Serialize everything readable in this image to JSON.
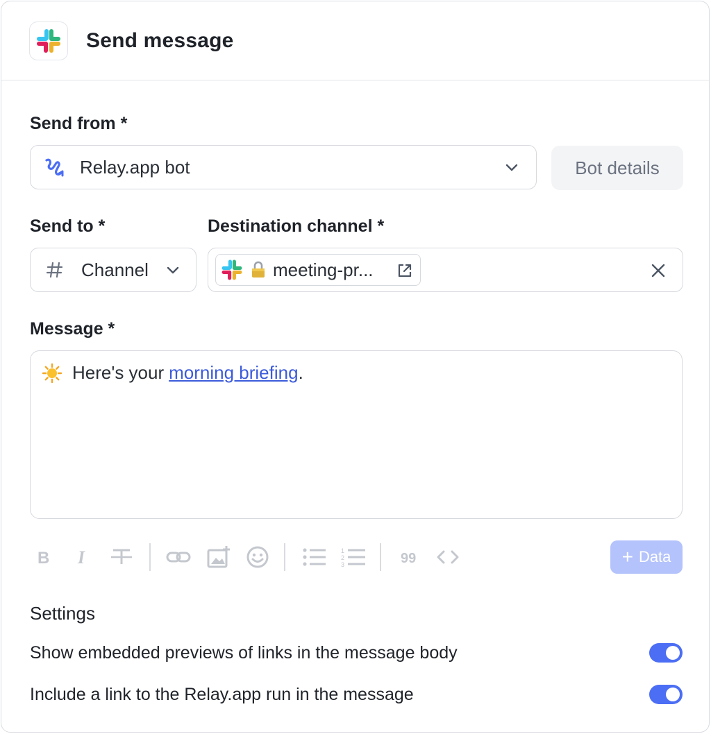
{
  "header": {
    "title": "Send message",
    "icon": "slack-icon"
  },
  "send_from": {
    "label": "Send from *",
    "value": "Relay.app bot",
    "icon": "relay-icon",
    "details_button": "Bot details"
  },
  "send_to": {
    "label": "Send to *",
    "value": "Channel",
    "icon": "hash-icon"
  },
  "destination": {
    "label": "Destination channel *",
    "chip_text": "meeting-pr...",
    "icons": [
      "slack-icon",
      "lock-icon",
      "external-link-icon",
      "close-icon"
    ]
  },
  "message": {
    "label": "Message *",
    "emoji": "☀️",
    "text_before": "Here's your",
    "link_text": "morning briefing",
    "text_after": "."
  },
  "toolbar": {
    "tools": [
      "bold",
      "italic",
      "strikethrough",
      "link",
      "add-image",
      "emoji",
      "bullet-list",
      "numbered-list",
      "quote",
      "code"
    ],
    "data_button": "Data"
  },
  "settings": {
    "title": "Settings",
    "items": [
      {
        "label": "Show embedded previews of links in the message body",
        "enabled": true
      },
      {
        "label": "Include a link to the Relay.app run in the message",
        "enabled": true
      }
    ]
  },
  "colors": {
    "accent": "#4c6ef5",
    "link": "#3b5bdb",
    "data_button": "#b4c3fb"
  }
}
